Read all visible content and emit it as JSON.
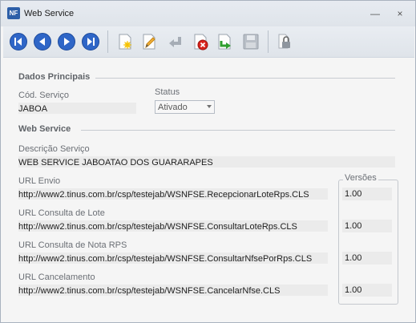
{
  "window": {
    "icon_text": "NF",
    "title": "Web Service",
    "minimize_glyph": "—",
    "close_glyph": "×"
  },
  "toolbar": {
    "buttons": [
      "first-record-icon",
      "previous-record-icon",
      "next-record-icon",
      "last-record-icon",
      "new-record-icon",
      "edit-record-icon",
      "undo-icon",
      "delete-icon",
      "export-icon",
      "save-icon",
      "lock-icon"
    ]
  },
  "sections": {
    "dados_principais": "Dados Principais",
    "web_service": "Web Service"
  },
  "fields": {
    "cod_servico_label": "Cód. Serviço",
    "cod_servico_value": "JABOA",
    "status_label": "Status",
    "status_value": "Ativado",
    "descricao_label": "Descrição Serviço",
    "descricao_value": "WEB SERVICE JABOATAO DOS GUARARAPES",
    "url_envio_label": "URL Envio",
    "url_envio_value": "http://www2.tinus.com.br/csp/testejab/WSNFSE.RecepcionarLoteRps.CLS",
    "url_consulta_lote_label": "URL Consulta de Lote",
    "url_consulta_lote_value": "http://www2.tinus.com.br/csp/testejab/WSNFSE.ConsultarLoteRps.CLS",
    "url_consulta_nota_label": "URL Consulta de Nota RPS",
    "url_consulta_nota_value": "http://www2.tinus.com.br/csp/testejab/WSNFSE.ConsultarNfsePorRps.CLS",
    "url_cancelamento_label": "URL Cancelamento",
    "url_cancelamento_value": "http://www2.tinus.com.br/csp/testejab/WSNFSE.CancelarNfse.CLS"
  },
  "versions": {
    "label": "Versões",
    "envio": "1.00",
    "consulta_lote": "1.00",
    "consulta_nota": "1.00",
    "cancelamento": "1.00"
  }
}
